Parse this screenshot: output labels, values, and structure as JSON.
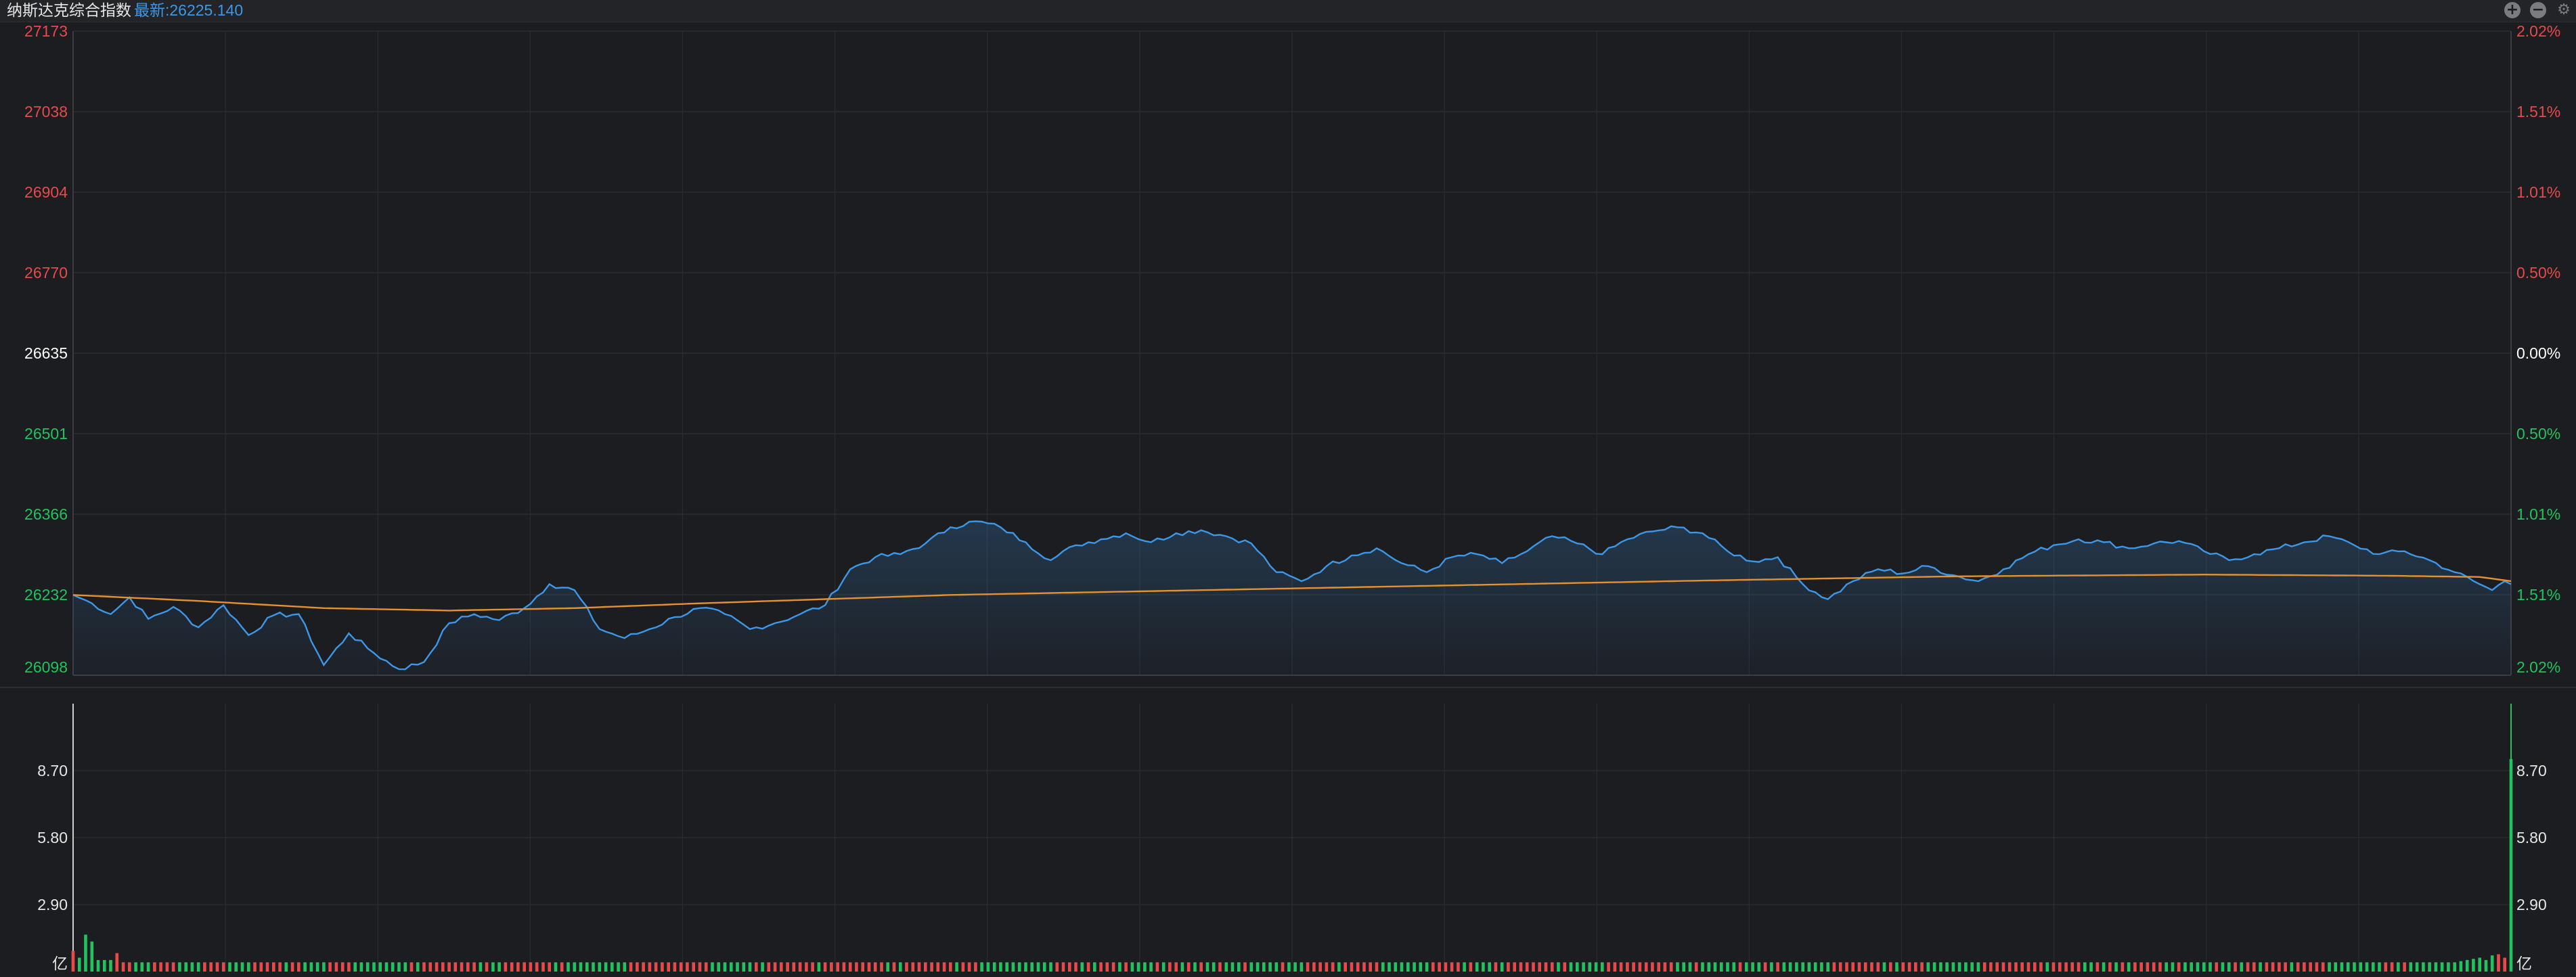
{
  "header": {
    "title": "纳斯达克综合指数",
    "latest_label": "最新:26225.140",
    "zoom_in_icon": "plus-circle-icon",
    "zoom_out_icon": "minus-circle-icon",
    "settings_icon": "gear-icon"
  },
  "colors": {
    "background": "#1c1d21",
    "up": "#e84a4a",
    "down": "#22c25e",
    "neutral": "#ffffff",
    "price_line": "#3d97e6",
    "avg_line": "#e6902e",
    "grid": "#2a2c31"
  },
  "chart_data": [
    {
      "type": "line",
      "title": "纳斯达克综合指数",
      "prev_close": 26635,
      "y_ticks_left": [
        "27173",
        "27038",
        "26904",
        "26770",
        "26635",
        "26501",
        "26366",
        "26232",
        "26098"
      ],
      "y_ticks_right": [
        "2.02%",
        "1.51%",
        "1.01%",
        "0.50%",
        "0.00%",
        "0.50%",
        "1.01%",
        "1.51%",
        "2.02%"
      ],
      "ylim": [
        26098,
        27173
      ],
      "grid": true,
      "x_points": 390,
      "series": [
        {
          "role": "price",
          "keypoints": [
            [
              0,
              26232
            ],
            [
              3,
              26218
            ],
            [
              6,
              26200
            ],
            [
              9,
              26228
            ],
            [
              12,
              26192
            ],
            [
              16,
              26212
            ],
            [
              20,
              26178
            ],
            [
              24,
              26215
            ],
            [
              28,
              26165
            ],
            [
              32,
              26198
            ],
            [
              36,
              26200
            ],
            [
              40,
              26115
            ],
            [
              44,
              26168
            ],
            [
              48,
              26135
            ],
            [
              52,
              26108
            ],
            [
              56,
              26120
            ],
            [
              60,
              26185
            ],
            [
              64,
              26200
            ],
            [
              68,
              26190
            ],
            [
              72,
              26210
            ],
            [
              76,
              26250
            ],
            [
              80,
              26240
            ],
            [
              84,
              26175
            ],
            [
              88,
              26160
            ],
            [
              92,
              26175
            ],
            [
              96,
              26195
            ],
            [
              100,
              26210
            ],
            [
              104,
              26200
            ],
            [
              108,
              26175
            ],
            [
              112,
              26185
            ],
            [
              116,
              26200
            ],
            [
              120,
              26215
            ],
            [
              124,
              26275
            ],
            [
              128,
              26295
            ],
            [
              132,
              26300
            ],
            [
              136,
              26318
            ],
            [
              140,
              26345
            ],
            [
              144,
              26355
            ],
            [
              148,
              26345
            ],
            [
              152,
              26320
            ],
            [
              156,
              26290
            ],
            [
              160,
              26315
            ],
            [
              164,
              26325
            ],
            [
              168,
              26335
            ],
            [
              172,
              26320
            ],
            [
              176,
              26335
            ],
            [
              180,
              26340
            ],
            [
              184,
              26330
            ],
            [
              188,
              26318
            ],
            [
              192,
              26270
            ],
            [
              196,
              26255
            ],
            [
              200,
              26280
            ],
            [
              204,
              26298
            ],
            [
              208,
              26310
            ],
            [
              212,
              26285
            ],
            [
              216,
              26270
            ],
            [
              220,
              26295
            ],
            [
              224,
              26300
            ],
            [
              228,
              26285
            ],
            [
              232,
              26305
            ],
            [
              236,
              26330
            ],
            [
              240,
              26318
            ],
            [
              244,
              26300
            ],
            [
              248,
              26325
            ],
            [
              252,
              26338
            ],
            [
              256,
              26345
            ],
            [
              260,
              26335
            ],
            [
              264,
              26305
            ],
            [
              268,
              26288
            ],
            [
              272,
              26295
            ],
            [
              276,
              26250
            ],
            [
              280,
              26225
            ],
            [
              284,
              26255
            ],
            [
              288,
              26275
            ],
            [
              292,
              26268
            ],
            [
              296,
              26280
            ],
            [
              300,
              26265
            ],
            [
              304,
              26255
            ],
            [
              308,
              26275
            ],
            [
              312,
              26300
            ],
            [
              316,
              26315
            ],
            [
              320,
              26325
            ],
            [
              324,
              26320
            ],
            [
              328,
              26310
            ],
            [
              332,
              26318
            ],
            [
              336,
              26322
            ],
            [
              340,
              26305
            ],
            [
              344,
              26290
            ],
            [
              348,
              26300
            ],
            [
              352,
              26310
            ],
            [
              356,
              26320
            ],
            [
              360,
              26330
            ],
            [
              364,
              26315
            ],
            [
              368,
              26300
            ],
            [
              372,
              26305
            ],
            [
              376,
              26290
            ],
            [
              380,
              26270
            ],
            [
              384,
              26250
            ],
            [
              386,
              26240
            ],
            [
              388,
              26255
            ],
            [
              389,
              26250
            ]
          ]
        },
        {
          "role": "average",
          "keypoints": [
            [
              0,
              26232
            ],
            [
              20,
              26222
            ],
            [
              40,
              26210
            ],
            [
              60,
              26206
            ],
            [
              80,
              26210
            ],
            [
              100,
              26218
            ],
            [
              140,
              26232
            ],
            [
              180,
              26240
            ],
            [
              220,
              26248
            ],
            [
              260,
              26256
            ],
            [
              300,
              26263
            ],
            [
              340,
              26266
            ],
            [
              370,
              26264
            ],
            [
              384,
              26262
            ],
            [
              389,
              26255
            ]
          ]
        }
      ]
    },
    {
      "type": "bar",
      "title": "",
      "y_ticks_left": [
        "8.70",
        "5.80",
        "2.90"
      ],
      "y_ticks_right": [
        "8.70",
        "5.80",
        "2.90"
      ],
      "ylim": [
        0,
        11.6
      ],
      "unit": "亿",
      "grid": true,
      "bars_head": [
        0.9,
        0.6,
        1.6,
        1.3,
        0.5,
        0.5,
        0.5,
        0.8
      ],
      "bars_tail": [
        0.45,
        0.5,
        0.55,
        0.6,
        0.5,
        0.7,
        0.75,
        0.6,
        9.2
      ],
      "bars_typical": 0.4
    }
  ]
}
